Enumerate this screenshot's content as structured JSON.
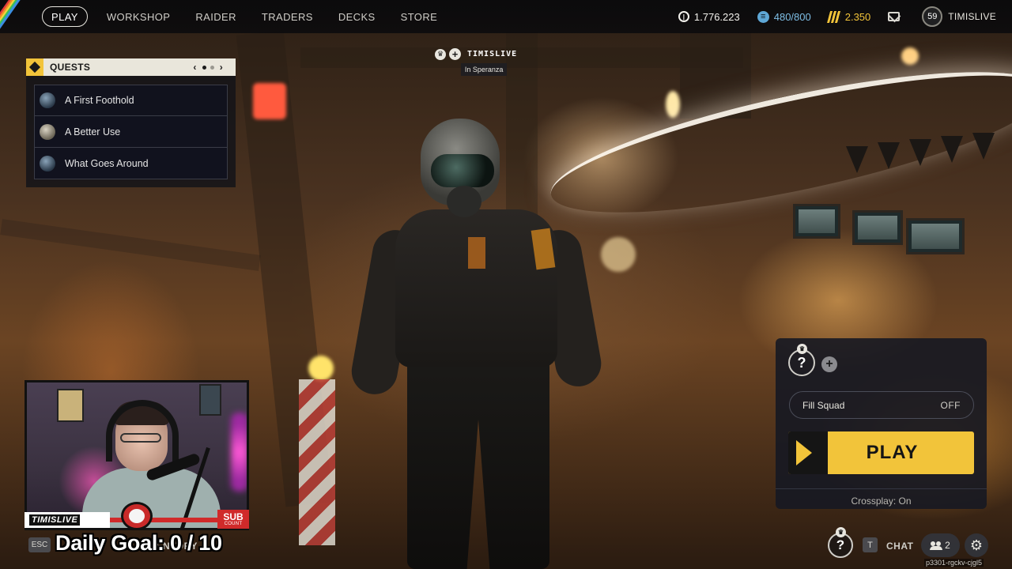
{
  "nav": {
    "items": [
      {
        "label": "PLAY",
        "active": true
      },
      {
        "label": "WORKSHOP"
      },
      {
        "label": "RAIDER"
      },
      {
        "label": "TRADERS"
      },
      {
        "label": "DECKS"
      },
      {
        "label": "STORE"
      }
    ]
  },
  "currencies": {
    "coins": "1.776.223",
    "stash": "480/800",
    "credits": "2.350"
  },
  "player": {
    "level": "59",
    "name": "TIMISLIVE"
  },
  "quests": {
    "title": "QUESTS",
    "prev": "‹",
    "next": "›",
    "items": [
      {
        "label": "A First Foothold"
      },
      {
        "label": "A Better Use"
      },
      {
        "label": "What Goes Around"
      }
    ]
  },
  "party": {
    "name": "TIMISLIVE",
    "status": "In Speranza"
  },
  "play_panel": {
    "slot_symbol": "?",
    "fill_squad_label": "Fill Squad",
    "fill_squad_state": "OFF",
    "play_label": "PLAY",
    "crossplay": "Crossplay: On"
  },
  "bottom": {
    "esc_key": "ESC",
    "inventory_label": "INVENTORY",
    "slot_symbol": "?",
    "chat_key": "T",
    "chat_label": "CHAT",
    "friends_count": "2",
    "build_id": "p3301-rgckv-cjgl5"
  },
  "overlay": {
    "daily_goal": "Daily Goal: 0 / 10",
    "streamer_tag": "TIMISLIVE",
    "sub_label": "SUB",
    "sub_count_label": "COUNT"
  },
  "colors": {
    "accent": "#f2c43a",
    "stash": "#5ea7d6",
    "panel": "#16182a"
  }
}
